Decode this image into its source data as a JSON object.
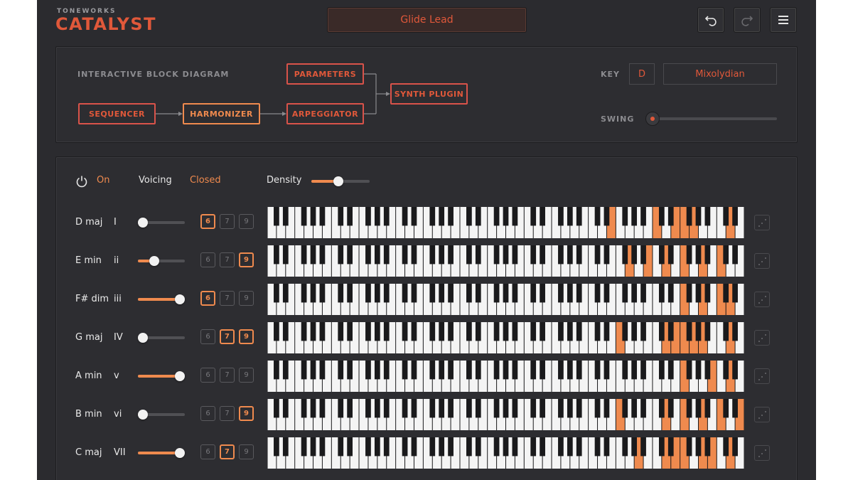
{
  "brand": {
    "top": "TONEWORKS",
    "name": "CATALYST"
  },
  "preset": {
    "name": "Glide Lead"
  },
  "header": {
    "buttons": [
      {
        "name": "undo-button",
        "icon": "undo-icon"
      },
      {
        "name": "redo-button",
        "icon": "redo-icon"
      },
      {
        "name": "menu-button",
        "icon": "hamburger-menu-icon"
      }
    ]
  },
  "diagram": {
    "title": "INTERACTIVE BLOCK DIAGRAM",
    "blocks": {
      "sequencer": "SEQUENCER",
      "harmonizer": "HARMONIZER",
      "arpeggiator": "ARPEGGIATOR",
      "parameters": "PARAMETERS",
      "synth": "SYNTH PLUGIN"
    },
    "active_block": "harmonizer"
  },
  "key": {
    "label": "KEY",
    "root": "D",
    "mode": "Mixolydian"
  },
  "swing": {
    "label": "SWING",
    "value": 0.0
  },
  "harmonizer": {
    "power_label": "On",
    "voicing_label": "Voicing",
    "voicing_value": "Closed",
    "density_label": "Density",
    "density_value": 0.45
  },
  "colors": {
    "accent": "#ef8a4e",
    "brand": "#e0583a",
    "panel": "#2d2d31"
  },
  "chords": [
    {
      "name": "D maj",
      "degree": "I",
      "level": 0.0,
      "ext": [
        6,
        7,
        9
      ],
      "ext_on": [
        6
      ],
      "notes": [
        37,
        42,
        44,
        45,
        46,
        50
      ]
    },
    {
      "name": "E min",
      "degree": "ii",
      "level": 0.3,
      "ext": [
        6,
        7,
        9
      ],
      "ext_on": [
        9
      ],
      "notes": [
        39,
        41,
        43,
        45,
        47,
        49,
        53
      ]
    },
    {
      "name": "F# dim",
      "degree": "iii",
      "level": 1.0,
      "ext": [
        6,
        7,
        9
      ],
      "ext_on": [
        6
      ],
      "notes": [
        45,
        47,
        49,
        50,
        52,
        55,
        58
      ]
    },
    {
      "name": "G maj",
      "degree": "IV",
      "level": 0.0,
      "ext": [
        6,
        7,
        9
      ],
      "ext_on": [
        7,
        9
      ],
      "notes": [
        38,
        43,
        44,
        45,
        46,
        47,
        50,
        52
      ]
    },
    {
      "name": "A min",
      "degree": "v",
      "level": 1.0,
      "ext": [
        6,
        7,
        9
      ],
      "ext_on": [],
      "notes": [
        45,
        48,
        50,
        52,
        54,
        56,
        59
      ]
    },
    {
      "name": "B min",
      "degree": "vi",
      "level": 0.0,
      "ext": [
        6,
        7,
        9
      ],
      "ext_on": [
        9
      ],
      "notes": [
        38,
        43,
        45,
        47,
        49,
        51,
        54
      ]
    },
    {
      "name": "C maj",
      "degree": "VII",
      "level": 1.0,
      "ext": [
        6,
        7,
        9
      ],
      "ext_on": [
        7
      ],
      "notes": [
        40,
        43,
        44,
        45,
        47,
        48,
        50,
        52,
        54
      ]
    }
  ]
}
